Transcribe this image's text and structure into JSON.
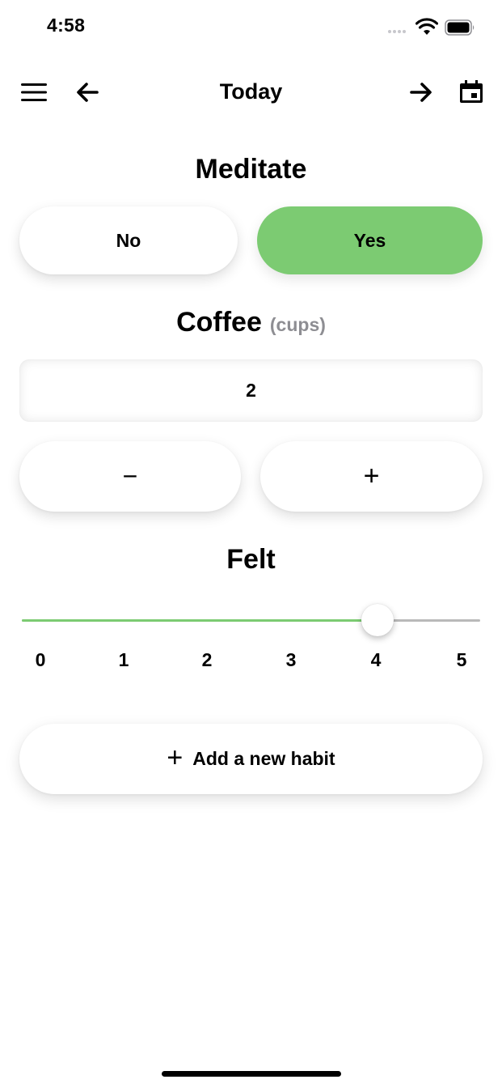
{
  "status_bar": {
    "time": "4:58",
    "icons": [
      "signal-icon",
      "wifi-icon",
      "battery-icon"
    ]
  },
  "nav": {
    "title": "Today",
    "icons": [
      "menu-icon",
      "arrow-left-icon",
      "arrow-right-icon",
      "calendar-icon"
    ]
  },
  "habits": {
    "meditate": {
      "title": "Meditate",
      "no_label": "No",
      "yes_label": "Yes",
      "selected": "Yes"
    },
    "coffee": {
      "title": "Coffee",
      "unit": "(cups)",
      "value": "2",
      "decrement_label": "−",
      "increment_label": "+"
    },
    "felt": {
      "title": "Felt",
      "min": 0,
      "max": 5,
      "value": 4,
      "ticks": [
        "0",
        "1",
        "2",
        "3",
        "4",
        "5"
      ]
    }
  },
  "add_habit": {
    "icon": "+",
    "label": "Add a new habit"
  },
  "colors": {
    "accent": "#7ccb72",
    "track": "#b9b9b9",
    "muted_text": "#8e8e93"
  }
}
